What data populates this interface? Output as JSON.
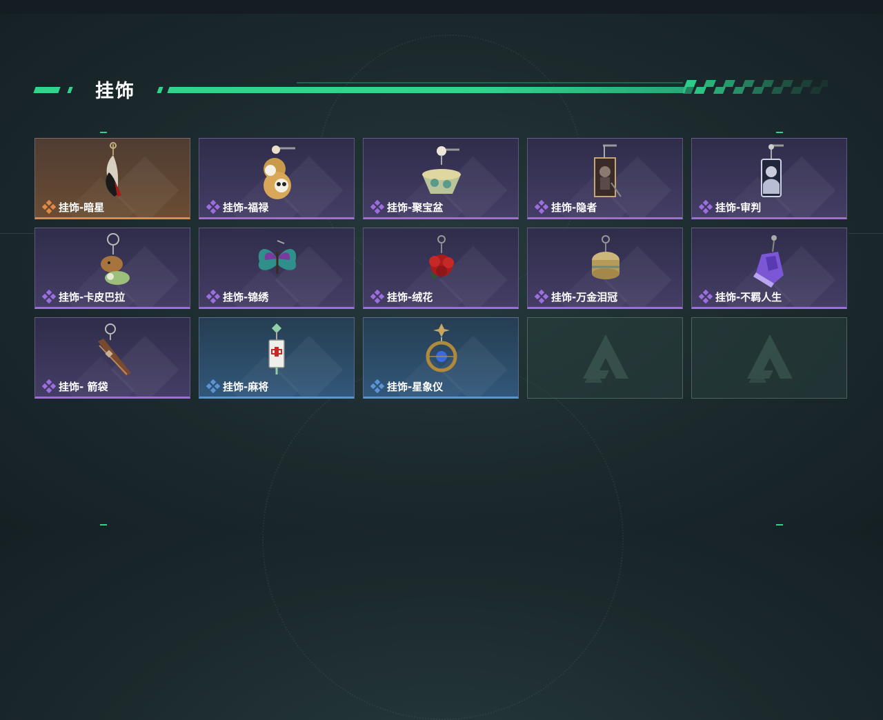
{
  "page": {
    "title": "挂饰",
    "accent": "#2fd58d"
  },
  "rarity_colors": {
    "orange": "#e28a45",
    "purple": "#9d6ee0",
    "blue": "#5b95d8"
  },
  "items": [
    {
      "label": "挂饰-暗星",
      "rarity": "orange",
      "icon": "black-bird-charm-icon"
    },
    {
      "label": "挂饰-福禄",
      "rarity": "purple",
      "icon": "gourd-panda-charm-icon"
    },
    {
      "label": "挂饰-聚宝盆",
      "rarity": "purple",
      "icon": "treasure-bowl-charm-icon"
    },
    {
      "label": "挂饰-隐者",
      "rarity": "purple",
      "icon": "hermit-card-charm-icon"
    },
    {
      "label": "挂饰-审判",
      "rarity": "purple",
      "icon": "judgement-card-charm-icon"
    },
    {
      "label": "挂饰-卡皮巴拉",
      "rarity": "purple",
      "icon": "capybara-charm-icon"
    },
    {
      "label": "挂饰-锦绣",
      "rarity": "purple",
      "icon": "butterfly-charm-icon"
    },
    {
      "label": "挂饰-绒花",
      "rarity": "purple",
      "icon": "red-flower-charm-icon"
    },
    {
      "label": "挂饰-万金泪冠",
      "rarity": "purple",
      "icon": "golden-crown-charm-icon"
    },
    {
      "label": "挂饰-不羁人生",
      "rarity": "purple",
      "icon": "sneaker-charm-icon"
    },
    {
      "label": "挂饰- 箭袋",
      "rarity": "purple",
      "icon": "quiver-charm-icon"
    },
    {
      "label": "挂饰-麻将",
      "rarity": "blue",
      "icon": "mahjong-tile-charm-icon"
    },
    {
      "label": "挂饰-星象仪",
      "rarity": "blue",
      "icon": "astrolabe-charm-icon"
    },
    {
      "label": "",
      "rarity": "empty",
      "icon": "empty-slot-logo-icon"
    },
    {
      "label": "",
      "rarity": "empty",
      "icon": "empty-slot-logo-icon"
    }
  ]
}
